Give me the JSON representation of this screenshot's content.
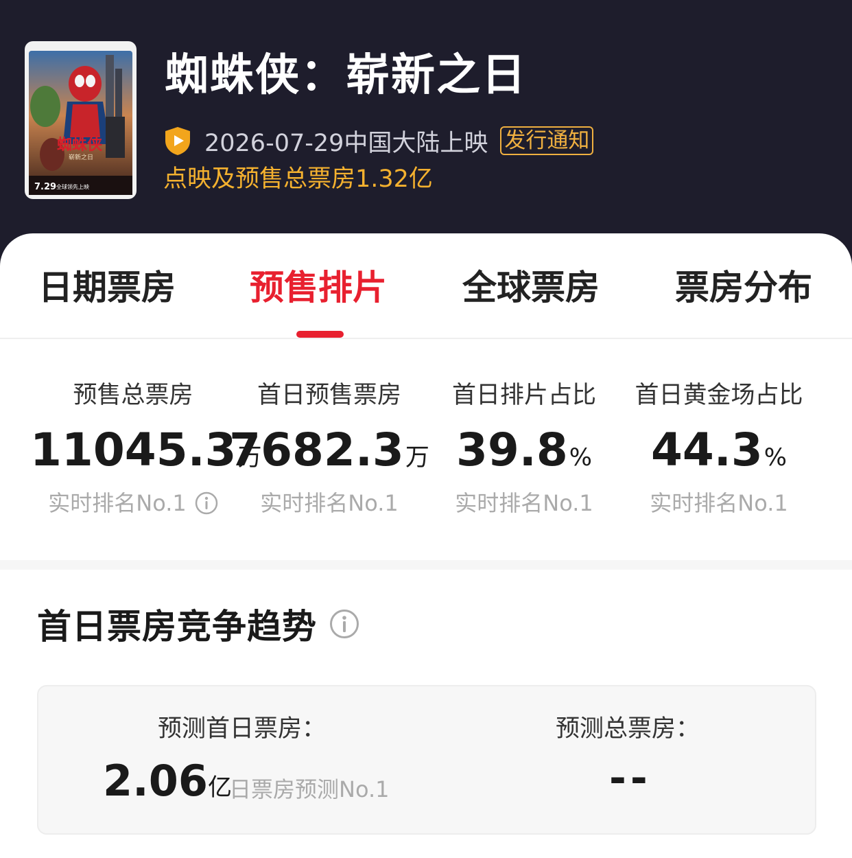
{
  "movie": {
    "title": "蜘蛛侠：崭新之日",
    "release_text": "2026-07-29中国大陆上映",
    "release_badge": "发行通知",
    "presale_total": "点映及预售总票房1.32亿",
    "poster": {
      "date_text": "7.29",
      "tagline": "全球领先上映",
      "title_cn": "蜘蛛侠",
      "subtitle_cn": "崭新之日"
    }
  },
  "colors": {
    "accent": "#e8202f",
    "gold": "#f4b12f",
    "header_bg": "#1e1d2c"
  },
  "tabs": [
    {
      "label": "日期票房",
      "active": false
    },
    {
      "label": "预售排片",
      "active": true
    },
    {
      "label": "全球票房",
      "active": false
    },
    {
      "label": "票房分布",
      "active": false
    }
  ],
  "stats": [
    {
      "label": "预售总票房",
      "value": "11045.3",
      "unit": "万",
      "rank": "实时排名No.1",
      "has_info": true
    },
    {
      "label": "首日预售票房",
      "value": "7682.3",
      "unit": "万",
      "rank": "实时排名No.1",
      "has_info": false
    },
    {
      "label": "首日排片占比",
      "value": "39.8",
      "unit": "%",
      "rank": "实时排名No.1",
      "has_info": false
    },
    {
      "label": "首日黄金场占比",
      "value": "44.3",
      "unit": "%",
      "rank": "实时排名No.1",
      "has_info": false
    }
  ],
  "section": {
    "title": "首日票房竞争趋势",
    "icon": "info-icon"
  },
  "forecast": {
    "first_day": {
      "label": "预测首日票房：",
      "value": "2.06",
      "unit": "亿",
      "rank": "日票房预测No.1"
    },
    "total": {
      "label": "预测总票房：",
      "value": "--"
    }
  }
}
